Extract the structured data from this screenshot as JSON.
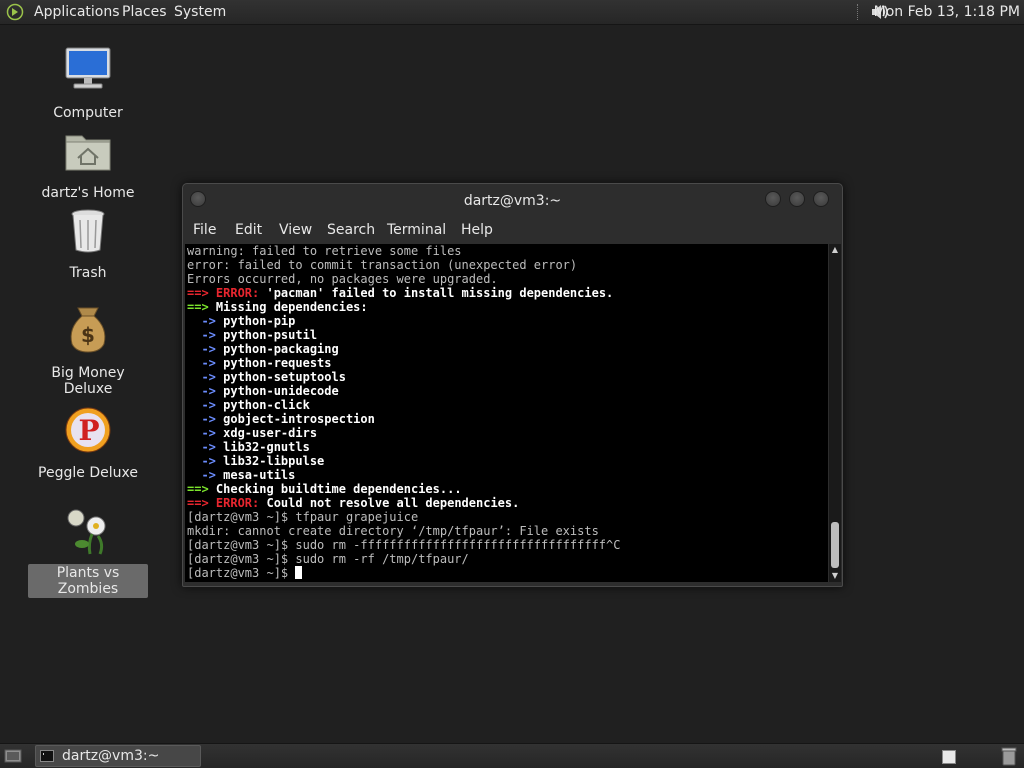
{
  "top_panel": {
    "menus": [
      "Applications",
      "Places",
      "System"
    ],
    "clock": "Mon Feb 13,  1:18 PM",
    "icons": {
      "menu_logo": "distro-logo-icon",
      "volume": "volume-icon"
    }
  },
  "desktop": {
    "icons": [
      {
        "label": "Computer",
        "icon": "computer-icon"
      },
      {
        "label": "dartz's Home",
        "icon": "home-folder-icon"
      },
      {
        "label": "Trash",
        "icon": "trash-icon"
      },
      {
        "label": "Big Money Deluxe",
        "icon": "money-bag-icon"
      },
      {
        "label": "Peggle Deluxe",
        "icon": "peggle-icon"
      },
      {
        "label": "Plants vs Zombies",
        "icon": "plants-vs-zombies-icon",
        "selected": true
      }
    ]
  },
  "terminal": {
    "title": "dartz@vm3:~",
    "menu": [
      "File",
      "Edit",
      "View",
      "Search",
      "Terminal",
      "Help"
    ],
    "lines": [
      [
        {
          "t": "warning: failed to retrieve some files",
          "c": ""
        }
      ],
      [
        {
          "t": "error: failed to commit transaction (unexpected error)",
          "c": ""
        }
      ],
      [
        {
          "t": "Errors occurred, no packages were upgraded.",
          "c": ""
        }
      ],
      [
        {
          "t": "==> ",
          "c": "red"
        },
        {
          "t": "ERROR: ",
          "c": "red"
        },
        {
          "t": "'pacman' failed to install missing dependencies.",
          "c": "b"
        }
      ],
      [
        {
          "t": "==> ",
          "c": "green"
        },
        {
          "t": "Missing dependencies:",
          "c": "b"
        }
      ],
      [
        {
          "t": "  -> ",
          "c": "blue"
        },
        {
          "t": "python-pip",
          "c": "b"
        }
      ],
      [
        {
          "t": "  -> ",
          "c": "blue"
        },
        {
          "t": "python-psutil",
          "c": "b"
        }
      ],
      [
        {
          "t": "  -> ",
          "c": "blue"
        },
        {
          "t": "python-packaging",
          "c": "b"
        }
      ],
      [
        {
          "t": "  -> ",
          "c": "blue"
        },
        {
          "t": "python-requests",
          "c": "b"
        }
      ],
      [
        {
          "t": "  -> ",
          "c": "blue"
        },
        {
          "t": "python-setuptools",
          "c": "b"
        }
      ],
      [
        {
          "t": "  -> ",
          "c": "blue"
        },
        {
          "t": "python-unidecode",
          "c": "b"
        }
      ],
      [
        {
          "t": "  -> ",
          "c": "blue"
        },
        {
          "t": "python-click",
          "c": "b"
        }
      ],
      [
        {
          "t": "  -> ",
          "c": "blue"
        },
        {
          "t": "gobject-introspection",
          "c": "b"
        }
      ],
      [
        {
          "t": "  -> ",
          "c": "blue"
        },
        {
          "t": "xdg-user-dirs",
          "c": "b"
        }
      ],
      [
        {
          "t": "  -> ",
          "c": "blue"
        },
        {
          "t": "lib32-gnutls",
          "c": "b"
        }
      ],
      [
        {
          "t": "  -> ",
          "c": "blue"
        },
        {
          "t": "lib32-libpulse",
          "c": "b"
        }
      ],
      [
        {
          "t": "  -> ",
          "c": "blue"
        },
        {
          "t": "mesa-utils",
          "c": "b"
        }
      ],
      [
        {
          "t": "==> ",
          "c": "green"
        },
        {
          "t": "Checking buildtime dependencies...",
          "c": "b"
        }
      ],
      [
        {
          "t": "==> ",
          "c": "red"
        },
        {
          "t": "ERROR: ",
          "c": "red"
        },
        {
          "t": "Could not resolve all dependencies.",
          "c": "b"
        }
      ],
      [
        {
          "t": "[dartz@vm3 ~]$ tfpaur grapejuice",
          "c": ""
        }
      ],
      [
        {
          "t": "mkdir: cannot create directory ‘/tmp/tfpaur’: File exists",
          "c": ""
        }
      ],
      [
        {
          "t": "[dartz@vm3 ~]$ sudo rm -ffffffffffffffffffffffffffffffffff^C",
          "c": ""
        }
      ],
      [
        {
          "t": "[dartz@vm3 ~]$ sudo rm -rf /tmp/tfpaur/",
          "c": ""
        }
      ],
      [
        {
          "t": "[dartz@vm3 ~]$ ",
          "c": ""
        }
      ]
    ]
  },
  "taskbar": {
    "task_label": "dartz@vm3:~",
    "icons": {
      "show_desktop": "show-desktop-icon",
      "task": "terminal-icon",
      "trash": "trash-applet-icon"
    }
  }
}
